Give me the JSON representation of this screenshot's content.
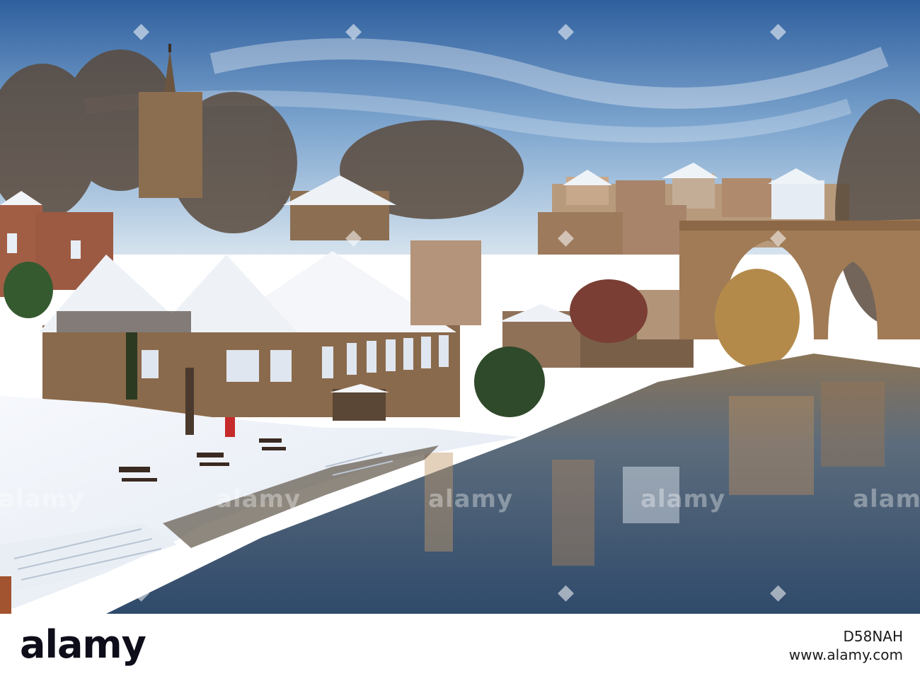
{
  "scene": {
    "subject": "snow-covered riverside town with stone viaduct reflected in calm river",
    "colors": {
      "sky_top": "#2f5f9e",
      "sky_low": "#c9dcec",
      "water": "#4e6177",
      "stone": "#8a6a48",
      "snow": "#f3f6fb"
    }
  },
  "watermark": {
    "text": "alamy",
    "icon": "alamy-diamond-icon"
  },
  "footer": {
    "logo": "alamy",
    "image_code": "D58NAH",
    "url": "www.alamy.com"
  }
}
